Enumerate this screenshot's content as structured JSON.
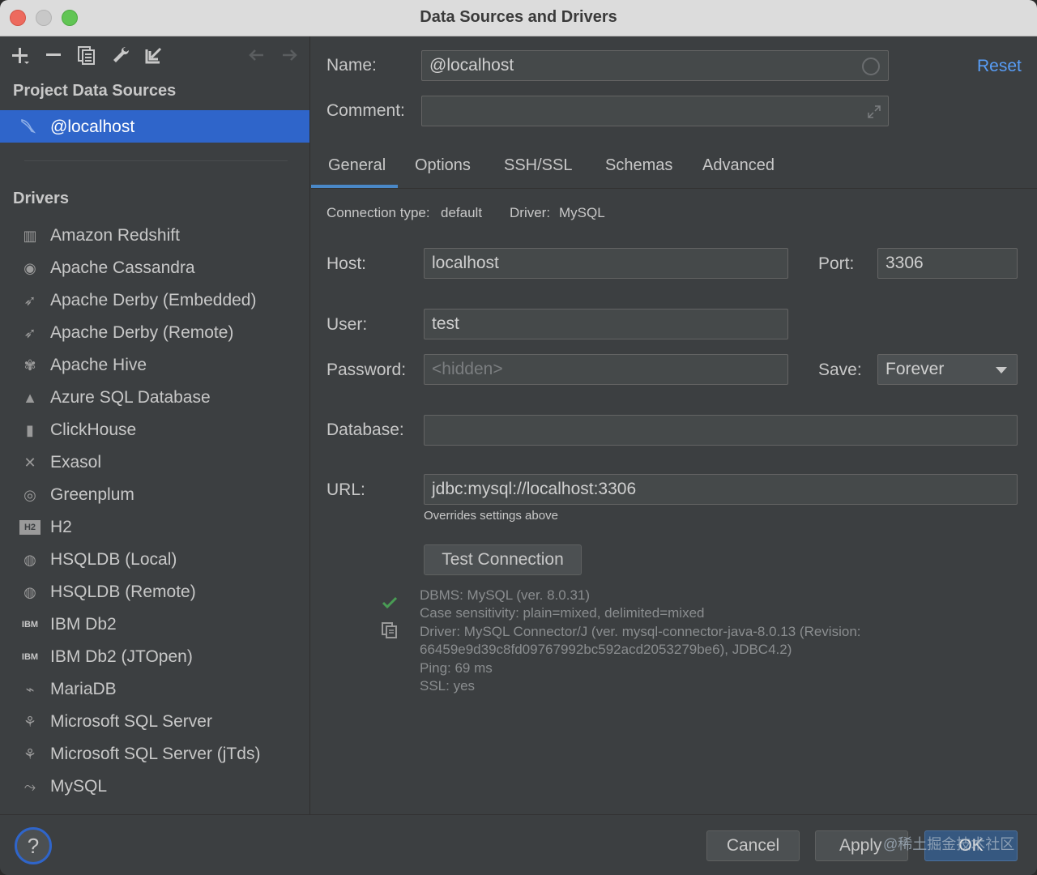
{
  "window": {
    "title": "Data Sources and Drivers"
  },
  "left_toolbar": {
    "icons": [
      "add-icon",
      "remove-icon",
      "duplicate-icon",
      "wrench-icon",
      "import-icon",
      "back-arrow-icon",
      "forward-arrow-icon"
    ]
  },
  "project_sources": {
    "title": "Project Data Sources",
    "items": [
      {
        "label": "@localhost",
        "icon": "mysql-dolphin-icon",
        "selected": true
      }
    ]
  },
  "drivers": {
    "title": "Drivers",
    "items": [
      {
        "label": "Amazon Redshift",
        "icon": "redshift-icon"
      },
      {
        "label": "Apache Cassandra",
        "icon": "cassandra-icon"
      },
      {
        "label": "Apache Derby (Embedded)",
        "icon": "derby-icon"
      },
      {
        "label": "Apache Derby (Remote)",
        "icon": "derby-icon"
      },
      {
        "label": "Apache Hive",
        "icon": "hive-icon"
      },
      {
        "label": "Azure SQL Database",
        "icon": "azure-icon"
      },
      {
        "label": "ClickHouse",
        "icon": "clickhouse-icon"
      },
      {
        "label": "Exasol",
        "icon": "exasol-icon"
      },
      {
        "label": "Greenplum",
        "icon": "greenplum-icon"
      },
      {
        "label": "H2",
        "icon": "h2-icon"
      },
      {
        "label": "HSQLDB (Local)",
        "icon": "hsqldb-icon"
      },
      {
        "label": "HSQLDB (Remote)",
        "icon": "hsqldb-icon"
      },
      {
        "label": "IBM Db2",
        "icon": "ibm-db2-icon"
      },
      {
        "label": "IBM Db2 (JTOpen)",
        "icon": "ibm-db2-icon"
      },
      {
        "label": "MariaDB",
        "icon": "mariadb-icon"
      },
      {
        "label": "Microsoft SQL Server",
        "icon": "mssql-icon"
      },
      {
        "label": "Microsoft SQL Server (jTds)",
        "icon": "mssql-icon"
      },
      {
        "label": "MySQL",
        "icon": "mysql-dolphin-icon"
      }
    ]
  },
  "header": {
    "name_label": "Name:",
    "name_value": "@localhost",
    "comment_label": "Comment:",
    "comment_value": "",
    "reset_label": "Reset"
  },
  "tabs": [
    {
      "label": "General",
      "active": true
    },
    {
      "label": "Options"
    },
    {
      "label": "SSH/SSL"
    },
    {
      "label": "Schemas"
    },
    {
      "label": "Advanced"
    }
  ],
  "general": {
    "connection_type_label": "Connection type:",
    "connection_type_value": "default",
    "driver_label": "Driver:",
    "driver_value": "MySQL",
    "host_label": "Host:",
    "host_value": "localhost",
    "port_label": "Port:",
    "port_value": "3306",
    "user_label": "User:",
    "user_value": "test",
    "password_label": "Password:",
    "password_placeholder": "<hidden>",
    "save_label": "Save:",
    "save_value": "Forever",
    "database_label": "Database:",
    "database_value": "",
    "url_label": "URL:",
    "url_value": "jdbc:mysql://localhost:3306",
    "url_hint": "Overrides settings above",
    "test_button": "Test Connection",
    "test_result": [
      "DBMS: MySQL (ver. 8.0.31)",
      "Case sensitivity: plain=mixed, delimited=mixed",
      "Driver: MySQL Connector/J (ver. mysql-connector-java-8.0.13 (Revision:",
      "66459e9d39c8fd09767992bc592acd2053279be6), JDBC4.2)",
      "Ping: 69 ms",
      "SSL: yes"
    ]
  },
  "footer": {
    "help_label": "?",
    "cancel_label": "Cancel",
    "apply_label": "Apply",
    "ok_label": "OK",
    "watermark": "@稀土掘金技术社区"
  },
  "colors": {
    "accent": "#2f65ca",
    "link": "#589df6",
    "success": "#499c54",
    "panel_bg": "#3c3f41"
  }
}
